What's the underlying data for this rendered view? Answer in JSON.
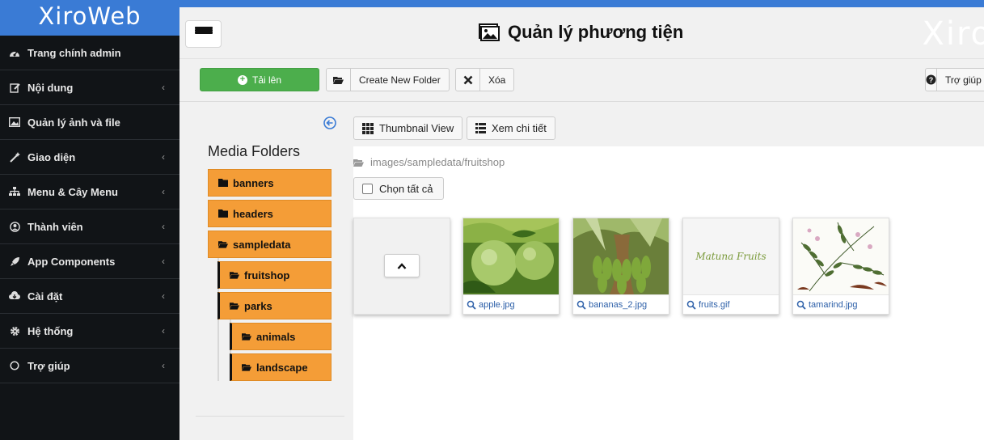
{
  "brand": "XiroWeb",
  "sidebar": {
    "items": [
      {
        "label": "Trang chính admin",
        "icon": "dashboard-icon",
        "chevron": false
      },
      {
        "label": "Nội dung",
        "icon": "edit-icon",
        "chevron": true
      },
      {
        "label": "Quản lý ảnh và file",
        "icon": "image-icon",
        "chevron": false
      },
      {
        "label": "Giao diện",
        "icon": "magic-wand-icon",
        "chevron": true
      },
      {
        "label": "Menu & Cây Menu",
        "icon": "sitemap-icon",
        "chevron": true
      },
      {
        "label": "Thành viên",
        "icon": "user-circle-icon",
        "chevron": true
      },
      {
        "label": "App Components",
        "icon": "rocket-icon",
        "chevron": true
      },
      {
        "label": "Cài đặt",
        "icon": "cloud-download-icon",
        "chevron": true
      },
      {
        "label": "Hệ thống",
        "icon": "cog-icon",
        "chevron": true
      },
      {
        "label": "Trợ giúp",
        "icon": "circle-icon",
        "chevron": true
      }
    ]
  },
  "header": {
    "title": "Quản lý phương tiện",
    "ghost_logo": "Xiro"
  },
  "toolbar": {
    "upload_label": "Tải lên",
    "new_folder_label": "Create New Folder",
    "delete_label": "Xóa",
    "help_label": "Trợ giúp"
  },
  "folders": {
    "heading": "Media Folders",
    "items": [
      {
        "label": "banners",
        "level": 0
      },
      {
        "label": "headers",
        "level": 0
      },
      {
        "label": "sampledata",
        "level": 0
      },
      {
        "label": "fruitshop",
        "level": 1
      },
      {
        "label": "parks",
        "level": 1
      },
      {
        "label": "animals",
        "level": 2
      },
      {
        "label": "landscape",
        "level": 2
      }
    ]
  },
  "content": {
    "thumbnail_view_label": "Thumbnail View",
    "detail_view_label": "Xem chi tiết",
    "path": "images/sampledata/fruitshop",
    "select_all_label": "Chọn tất cả",
    "files": [
      {
        "name": "apple.jpg"
      },
      {
        "name": "bananas_2.jpg"
      },
      {
        "name": "fruits.gif",
        "image_text": "Matuna Fruits"
      },
      {
        "name": "tamarind.jpg"
      }
    ]
  },
  "colors": {
    "brand_blue": "#3a7bd5",
    "sidebar_bg": "#111417",
    "upload_green": "#4cae4c",
    "folder_orange": "#f49d37",
    "link_blue": "#2c5fa8"
  }
}
